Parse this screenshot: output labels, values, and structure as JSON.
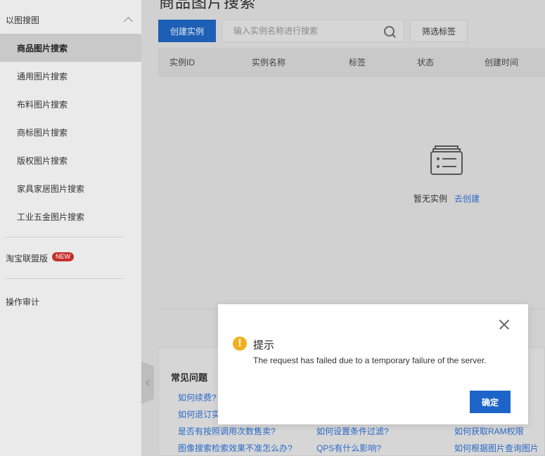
{
  "sidebar": {
    "group_label": "以图搜图",
    "items": [
      {
        "label": "商品图片搜索"
      },
      {
        "label": "通用图片搜索"
      },
      {
        "label": "布料图片搜索"
      },
      {
        "label": "商标图片搜索"
      },
      {
        "label": "版权图片搜索"
      },
      {
        "label": "家具家居图片搜索"
      },
      {
        "label": "工业五金图片搜索"
      }
    ],
    "taobao_label": "淘宝联盟版",
    "new_badge": "NEW",
    "audit_label": "操作审计"
  },
  "header": {
    "page_title": "商品图片搜索"
  },
  "toolbar": {
    "create_label": "创建实例",
    "search_placeholder": "输入实例名称进行搜索",
    "filter_label": "筛选标签"
  },
  "table": {
    "columns": [
      "实例ID",
      "实例名称",
      "标签",
      "状态",
      "创建时间"
    ],
    "empty_text": "暂无实例",
    "empty_link": "去创建"
  },
  "faq": {
    "title": "常见问题",
    "links": [
      "如何续费?",
      "如何退订实",
      "是否有按照调用次数售卖?",
      "图像搜索检索效果不准怎么办?",
      "如何设置条件过滤?",
      "QPS有什么影响?",
      "如何获取RAM权限",
      "如何根据图片查询图片"
    ]
  },
  "modal": {
    "title": "提示",
    "message": "The request has failed due to a temporary failure of the server.",
    "ok_label": "确定",
    "warn_glyph": "!"
  }
}
